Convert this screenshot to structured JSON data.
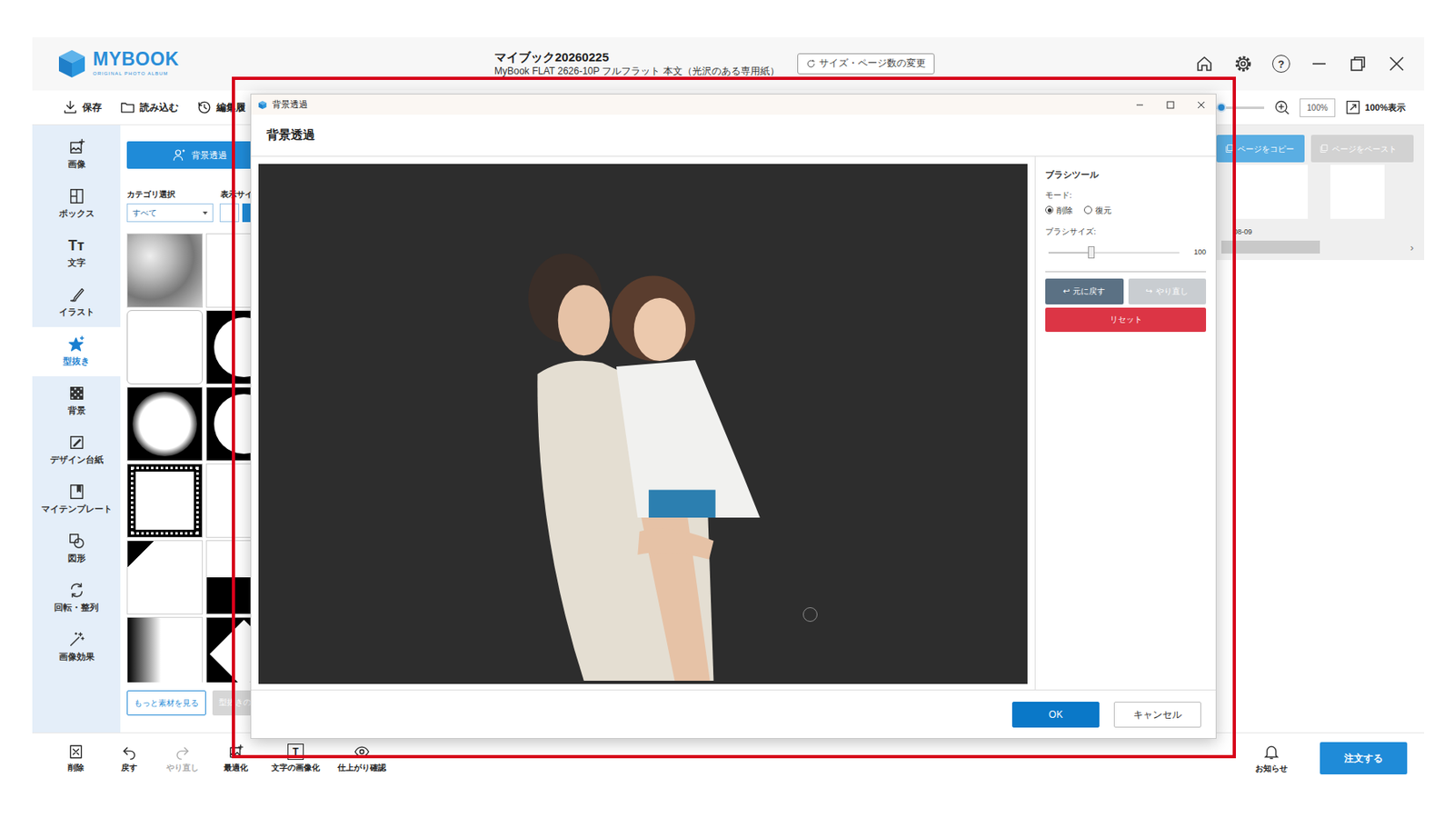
{
  "app": {
    "logo": {
      "name": "MYBOOK",
      "tagline": "ORIGINAL PHOTO ALBUM"
    },
    "title": "マイブック20260225",
    "subtitle": "MyBook FLAT 2626-10P フルフラット 本文（光沢のある専用紙）",
    "size_button": "サイズ・ページ数の変更",
    "help_icon": "?"
  },
  "toolbar": {
    "items": [
      {
        "label": "保存"
      },
      {
        "label": "読み込む"
      },
      {
        "label": "編集履"
      }
    ],
    "zoom": {
      "level": 0.45,
      "value": "100%",
      "fit_label": "100%表示"
    }
  },
  "sidebar": {
    "items": [
      {
        "label": "画像",
        "selected": false
      },
      {
        "label": "ボックス",
        "selected": false
      },
      {
        "label": "文字",
        "selected": false,
        "glyph": "Tт"
      },
      {
        "label": "イラスト",
        "selected": false
      },
      {
        "label": "型抜き",
        "selected": true
      },
      {
        "label": "背景",
        "selected": false
      },
      {
        "label": "デザイン台紙",
        "selected": false
      },
      {
        "label": "マイテンプレート",
        "selected": false
      },
      {
        "label": "図形",
        "selected": false
      },
      {
        "label": "回転・整列",
        "selected": false
      },
      {
        "label": "画像効果",
        "selected": false
      }
    ]
  },
  "panel": {
    "action_button": "背景透過",
    "category_label": "カテゴリ選択",
    "category_value": "すべて",
    "size_label": "表示サイ",
    "more_button": "もっと素材を見る",
    "second_button": "型抜きの"
  },
  "pages": {
    "buttons": [
      {
        "label": "ページをコピー",
        "disabled": false
      },
      {
        "label": "ページをペースト",
        "disabled": true
      }
    ],
    "label": "08-09",
    "scroll": "›"
  },
  "bottom_bar": {
    "items": [
      {
        "label": "削除",
        "disabled": false
      },
      {
        "label": "戻す",
        "disabled": false
      },
      {
        "label": "やり直し",
        "disabled": true
      },
      {
        "label": "最適化",
        "disabled": false
      },
      {
        "label": "文字の画像化",
        "disabled": false,
        "glyph": "T"
      },
      {
        "label": "仕上がり確認",
        "disabled": false
      }
    ],
    "notice": "お知らせ",
    "order_button": "注文する"
  },
  "dialog": {
    "title": "背景透過",
    "heading": "背景透過",
    "brush": {
      "title": "ブラシツール",
      "mode_label": "モード:",
      "modes": [
        {
          "label": "削除",
          "selected": true
        },
        {
          "label": "復元",
          "selected": false
        }
      ],
      "size_label": "ブラシサイズ:",
      "size": {
        "level": 0.33,
        "reading": "100"
      }
    },
    "history": [
      {
        "icon": "↩",
        "label": "元に戻す",
        "disabled": false
      },
      {
        "icon": "↪",
        "label": "やり直し",
        "disabled": true
      }
    ],
    "reset": "リセット",
    "buttons": [
      {
        "label": "OK",
        "kind": "primary"
      },
      {
        "label": "キャンセル",
        "kind": "secondary"
      }
    ]
  }
}
